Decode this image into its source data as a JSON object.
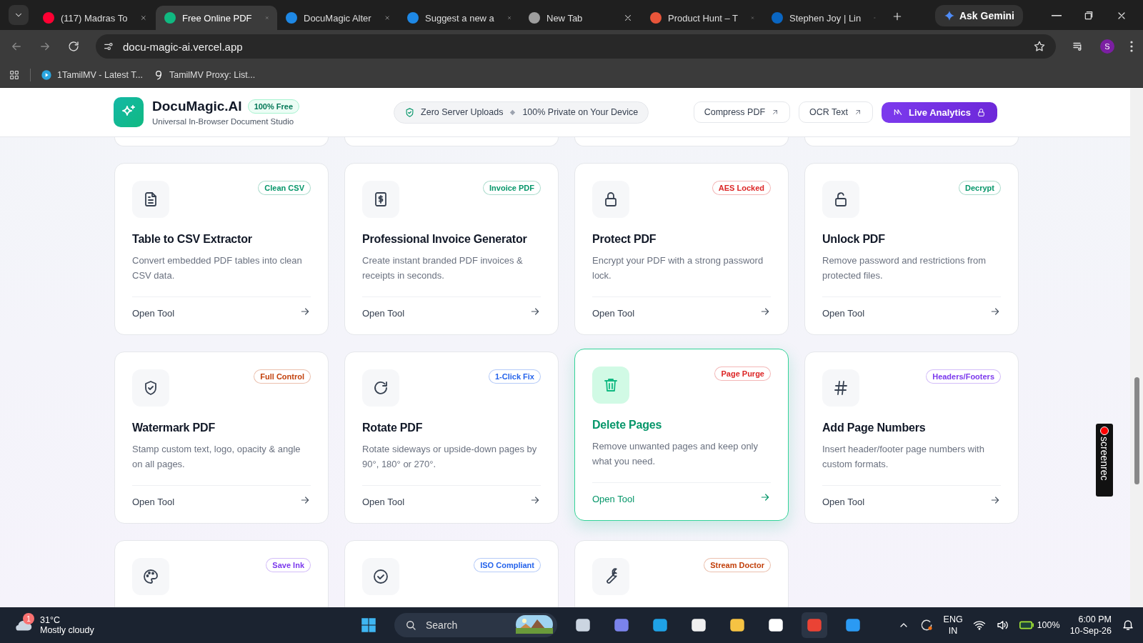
{
  "browser": {
    "tabs": [
      {
        "title": "(117) Madras To",
        "selected": false
      },
      {
        "title": "Free Online PDF",
        "selected": true
      },
      {
        "title": "DocuMagic Alter",
        "selected": false
      },
      {
        "title": "Suggest a new a",
        "selected": false
      },
      {
        "title": "New Tab",
        "selected": false
      },
      {
        "title": "Product Hunt – T",
        "selected": false
      },
      {
        "title": "Stephen Joy | Lin",
        "selected": false
      }
    ],
    "gemini": "Ask Gemini",
    "url": "docu-magic-ai.vercel.app",
    "profile": "S",
    "bookmarks": [
      "1TamilMV - Latest T...",
      "TamilMV Proxy: List..."
    ]
  },
  "header": {
    "brand": "DocuMagic.AI",
    "brand_badge": "100% Free",
    "tagline": "Universal In-Browser Document Studio",
    "privacy": [
      "Zero Server Uploads",
      "100% Private on Your Device"
    ],
    "links": [
      "Compress PDF",
      "OCR Text"
    ],
    "analytics": "Live Analytics"
  },
  "cards": [
    {
      "badge": "Clean CSV",
      "color": "#059669",
      "title": "Table to CSV Extractor",
      "description": "Convert embedded PDF tables into clean CSV data.",
      "action": "Open Tool",
      "highlighted": false
    },
    {
      "badge": "Invoice PDF",
      "color": "#059669",
      "title": "Professional Invoice Generator",
      "description": "Create instant branded PDF invoices & receipts in seconds.",
      "action": "Open Tool",
      "highlighted": false
    },
    {
      "badge": "AES Locked",
      "color": "#dc2626",
      "title": "Protect PDF",
      "description": "Encrypt your PDF with a strong password lock.",
      "action": "Open Tool",
      "highlighted": false
    },
    {
      "badge": "Decrypt",
      "color": "#059669",
      "title": "Unlock PDF",
      "description": "Remove password and restrictions from protected files.",
      "action": "Open Tool",
      "highlighted": false
    },
    {
      "badge": "Full Control",
      "color": "#c2410c",
      "title": "Watermark PDF",
      "description": "Stamp custom text, logo, opacity & angle on all pages.",
      "action": "Open Tool",
      "highlighted": false
    },
    {
      "badge": "1-Click Fix",
      "color": "#2563eb",
      "title": "Rotate PDF",
      "description": "Rotate sideways or upside-down pages by 90°, 180° or 270°.",
      "action": "Open Tool",
      "highlighted": false
    },
    {
      "badge": "Page Purge",
      "color": "#dc2626",
      "title": "Delete Pages",
      "description": "Remove unwanted pages and keep only what you need.",
      "action": "Open Tool",
      "highlighted": true
    },
    {
      "badge": "Headers/Footers",
      "color": "#7c3aed",
      "title": "Add Page Numbers",
      "description": "Insert header/footer page numbers with custom formats.",
      "action": "Open Tool",
      "highlighted": false
    },
    {
      "badge": "Save Ink",
      "color": "#7c3aed",
      "highlighted": false
    },
    {
      "badge": "ISO Compliant",
      "color": "#2563eb",
      "highlighted": false
    },
    {
      "badge": "Stream Doctor",
      "color": "#c2410c",
      "highlighted": false
    }
  ],
  "recorder": "screenrec",
  "taskbar": {
    "weather_alerts": "1",
    "temperature": "31°C",
    "condition": "Mostly cloudy",
    "search": "Search",
    "language": "ENG",
    "region": "IN",
    "battery": "100%",
    "time": "6:00 PM",
    "date": "10-Sep-26"
  }
}
